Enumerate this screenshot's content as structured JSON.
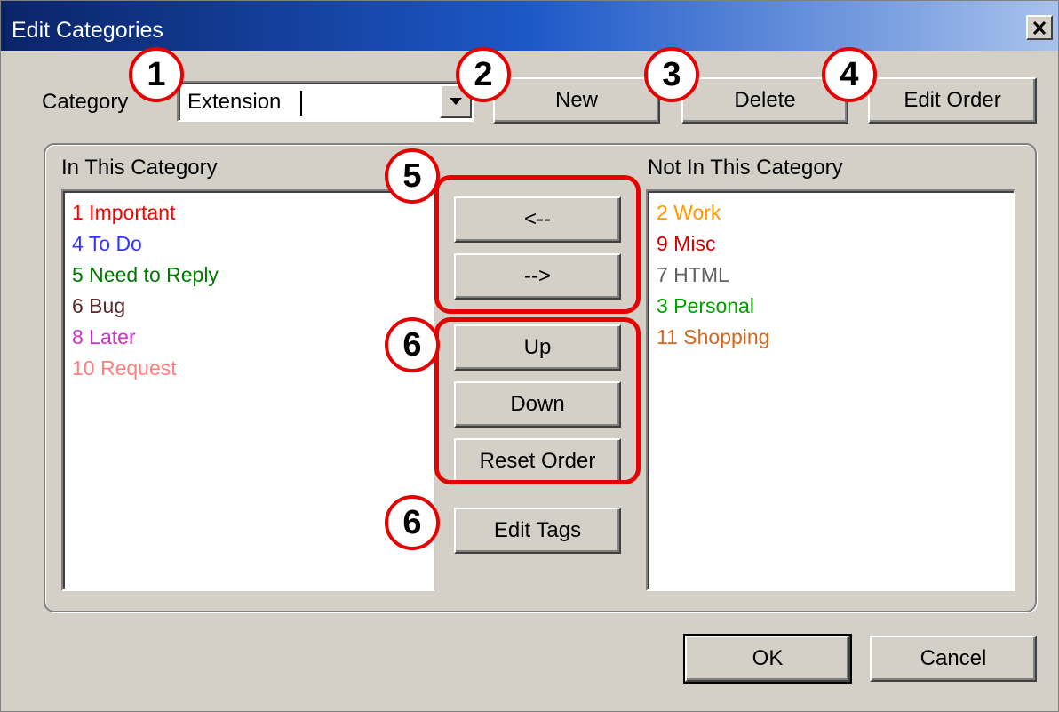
{
  "window": {
    "title": "Edit Categories",
    "close_icon": "close-x-icon"
  },
  "category": {
    "label": "Category",
    "value": "Extension",
    "dropdown_icon": "chevron-down-icon"
  },
  "toolbar": {
    "new_label": "New",
    "delete_label": "Delete",
    "edit_order_label": "Edit Order"
  },
  "in_category": {
    "heading": "In This Category",
    "items": [
      {
        "label": "1 Important",
        "color": "#ff0000"
      },
      {
        "label": "4 To Do",
        "color": "#3333ff"
      },
      {
        "label": "5 Need to Reply",
        "color": "#007a00"
      },
      {
        "label": "6 Bug",
        "color": "#5a2a2a"
      },
      {
        "label": "8 Later",
        "color": "#cc33cc"
      },
      {
        "label": "10 Request",
        "color": "#ff8080"
      }
    ]
  },
  "not_in_category": {
    "heading": "Not In This Category",
    "items": [
      {
        "label": "2 Work",
        "color": "#ff9900"
      },
      {
        "label": "9 Misc",
        "color": "#cc0000"
      },
      {
        "label": "7 HTML",
        "color": "#606060"
      },
      {
        "label": "3 Personal",
        "color": "#00a000"
      },
      {
        "label": "11 Shopping",
        "color": "#d2691e"
      }
    ]
  },
  "move_buttons": {
    "add_label": "<--",
    "remove_label": "-->"
  },
  "order_buttons": {
    "up_label": "Up",
    "down_label": "Down",
    "reset_label": "Reset Order"
  },
  "edit_tags_label": "Edit Tags",
  "footer": {
    "ok_label": "OK",
    "cancel_label": "Cancel"
  },
  "callouts": {
    "c1": "1",
    "c2": "2",
    "c3": "3",
    "c4": "4",
    "c5": "5",
    "c6a": "6",
    "c6b": "6"
  },
  "colors": {
    "callout_red": "#e60000",
    "title_gradient_start": "#0a2468",
    "dialog_bg": "#d4d0c8"
  }
}
